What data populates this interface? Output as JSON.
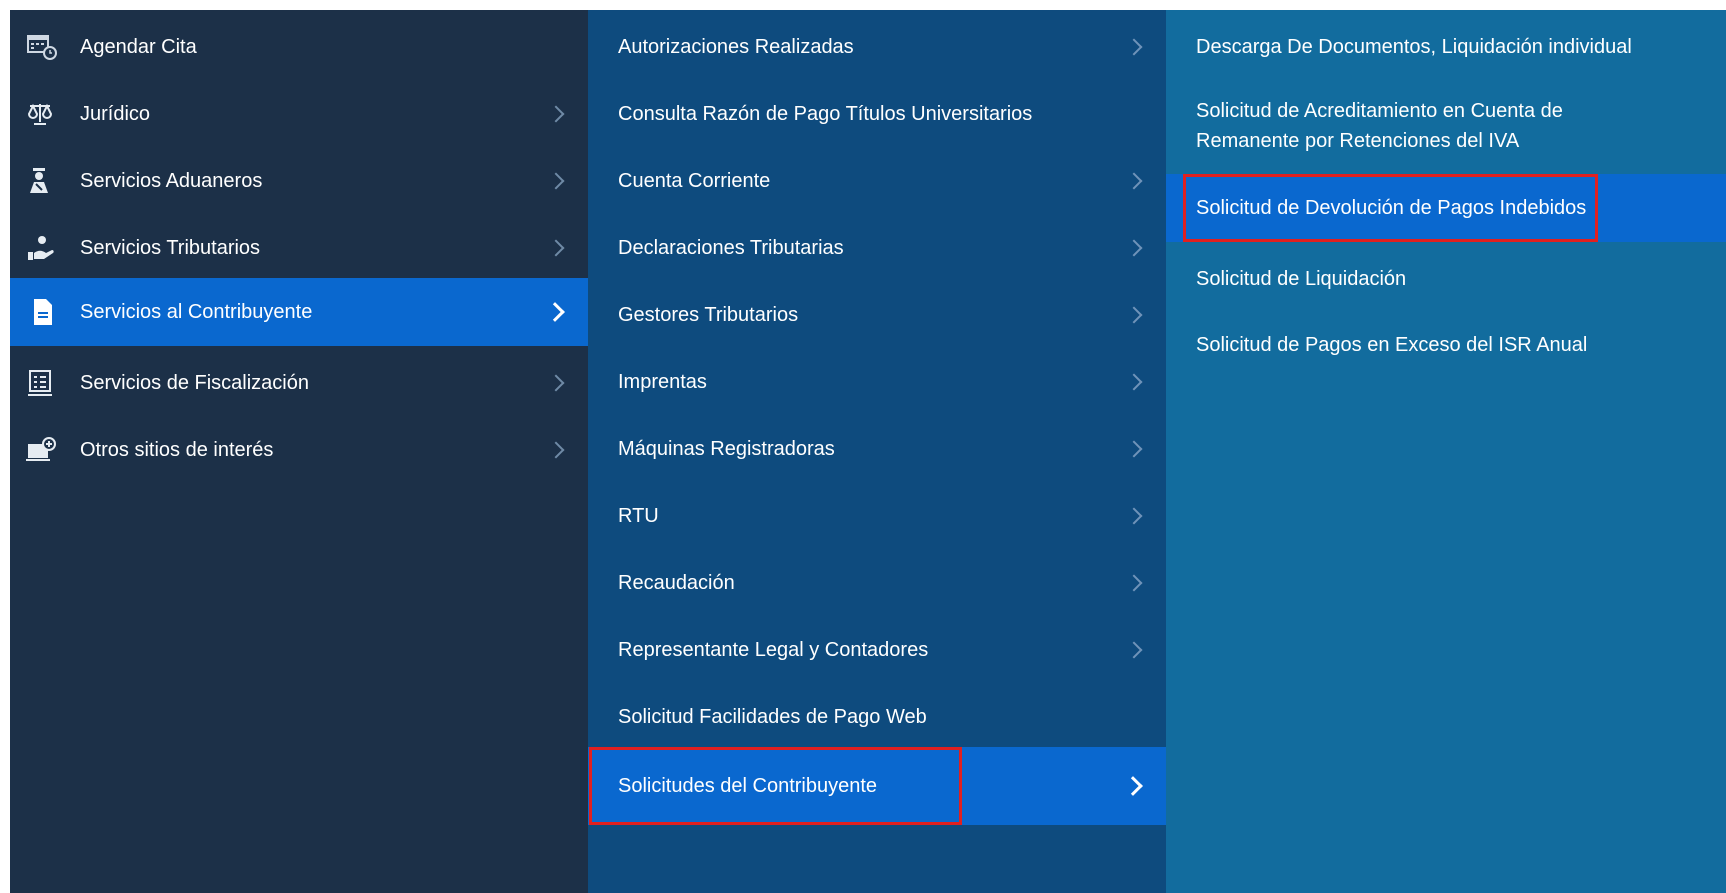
{
  "menu_level1": [
    {
      "label": "Agendar Cita",
      "icon": "calendar-clock-icon",
      "has_submenu": false
    },
    {
      "label": "Jurídico",
      "icon": "scales-icon",
      "has_submenu": true
    },
    {
      "label": "Servicios Aduaneros",
      "icon": "customs-officer-icon",
      "has_submenu": true
    },
    {
      "label": "Servicios Tributarios",
      "icon": "hand-coin-icon",
      "has_submenu": true
    },
    {
      "label": "Servicios al Contribuyente",
      "icon": "document-icon",
      "has_submenu": true,
      "active": true
    },
    {
      "label": "Servicios de Fiscalización",
      "icon": "checklist-icon",
      "has_submenu": true
    },
    {
      "label": "Otros sitios de interés",
      "icon": "monitor-plus-icon",
      "has_submenu": true
    }
  ],
  "menu_level2": [
    {
      "label": "Autorizaciones Realizadas",
      "has_submenu": true
    },
    {
      "label": "Consulta Razón de Pago Títulos Universitarios",
      "has_submenu": false
    },
    {
      "label": "Cuenta Corriente",
      "has_submenu": true
    },
    {
      "label": "Declaraciones Tributarias",
      "has_submenu": true
    },
    {
      "label": "Gestores Tributarios",
      "has_submenu": true
    },
    {
      "label": "Imprentas",
      "has_submenu": true
    },
    {
      "label": "Máquinas Registradoras",
      "has_submenu": true
    },
    {
      "label": "RTU",
      "has_submenu": true
    },
    {
      "label": "Recaudación",
      "has_submenu": true
    },
    {
      "label": "Representante Legal y Contadores",
      "has_submenu": true
    },
    {
      "label": "Solicitud Facilidades de Pago Web",
      "has_submenu": false
    },
    {
      "label": "Solicitudes del Contribuyente",
      "has_submenu": true,
      "active": true,
      "highlighted": true
    }
  ],
  "menu_level3": [
    {
      "label": "Descarga De Documentos, Liquidación individual"
    },
    {
      "label": "Solicitud de Acreditamiento en Cuenta de Remanente por Retenciones del IVA"
    },
    {
      "label": "Solicitud de Devolución de Pagos Indebidos",
      "active": true,
      "highlighted": true
    },
    {
      "label": "Solicitud de Liquidación"
    },
    {
      "label": "Solicitud de Pagos en Exceso del ISR Anual"
    }
  ],
  "colors": {
    "level1_bg": "#1c3048",
    "level2_bg": "#0e4b7e",
    "level3_bg": "#126c9e",
    "active_bg": "#0a68cf",
    "highlight_border": "#e02020"
  }
}
